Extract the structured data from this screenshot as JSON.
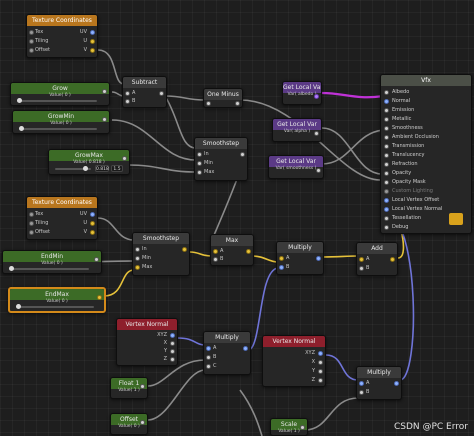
{
  "nodes": {
    "tex1": {
      "title": "Texture Coordinates",
      "inputs": [
        "Tex",
        "Tiling",
        "Offset"
      ],
      "outputs": [
        "UV",
        "U",
        "V"
      ]
    },
    "grow": {
      "title": "Grow",
      "value": "Value( 0 )"
    },
    "growmin": {
      "title": "GrowMin",
      "value": "Value( 0 )"
    },
    "growmax": {
      "title": "GrowMax",
      "value": "Value( 0.818 )",
      "num1": "0.818",
      "num2": "1.5"
    },
    "subtract": {
      "title": "Subtract",
      "inputs": [
        "A",
        "B"
      ]
    },
    "oneminus": {
      "title": "One Minus"
    },
    "smoothstep1": {
      "title": "Smoothstep",
      "inputs": [
        "In",
        "Min",
        "Max"
      ]
    },
    "getlocal1": {
      "title": "Get Local Var",
      "value": "Var( albedo )"
    },
    "getlocal2": {
      "title": "Get Local Var",
      "value": "Var( alpha )"
    },
    "getlocal3": {
      "title": "Get Local Var",
      "value": "Var( smoothness )"
    },
    "tex2": {
      "title": "Texture Coordinates",
      "inputs": [
        "Tex",
        "Tiling",
        "Offset"
      ],
      "outputs": [
        "UV",
        "U",
        "V"
      ]
    },
    "endmin": {
      "title": "EndMin",
      "value": "Value( 0 )"
    },
    "endmax": {
      "title": "EndMax",
      "value": "Value( 0 )"
    },
    "smoothstep2": {
      "title": "Smoothstep",
      "inputs": [
        "In",
        "Min",
        "Max"
      ]
    },
    "max": {
      "title": "Max",
      "inputs": [
        "A",
        "B"
      ]
    },
    "multiply1": {
      "title": "Multiply",
      "inputs": [
        "A",
        "B"
      ]
    },
    "add": {
      "title": "Add",
      "inputs": [
        "A",
        "B"
      ]
    },
    "vertexnormal1": {
      "title": "Vertex Normal",
      "outputs": [
        "XYZ",
        "X",
        "Y",
        "Z"
      ]
    },
    "multiply2": {
      "title": "Multiply",
      "inputs": [
        "A",
        "B",
        "C"
      ]
    },
    "vertexnormal2": {
      "title": "Vertex Normal",
      "outputs": [
        "XYZ",
        "X",
        "Y",
        "Z"
      ]
    },
    "multiply3": {
      "title": "Multiply",
      "inputs": [
        "A",
        "B"
      ]
    },
    "float1": {
      "title": "Float 1",
      "value": "Value( 1 )"
    },
    "offset": {
      "title": "Offset",
      "value": "Value( 0 )"
    },
    "scale": {
      "title": "Scale",
      "value": "Value( 1 )"
    },
    "output": {
      "title": "Vfx",
      "ports": [
        "Albedo",
        "Normal",
        "Emission",
        "Metallic",
        "Smoothness",
        "Ambient Occlusion",
        "Transmission",
        "Translucency",
        "Refraction",
        "Opacity",
        "Opacity Mask",
        "Custom Lighting",
        "Local Vertex Offset",
        "Local Vertex Normal",
        "Tessellation",
        "Debug"
      ]
    }
  },
  "watermark": "CSDN @PC Error",
  "colors": {
    "accent_orange": "#d48a1a",
    "wire_gray": "#8a8a8a",
    "wire_blue": "#6f74d8",
    "wire_yellow": "#e6c23a",
    "wire_magenta": "#c032d8"
  }
}
